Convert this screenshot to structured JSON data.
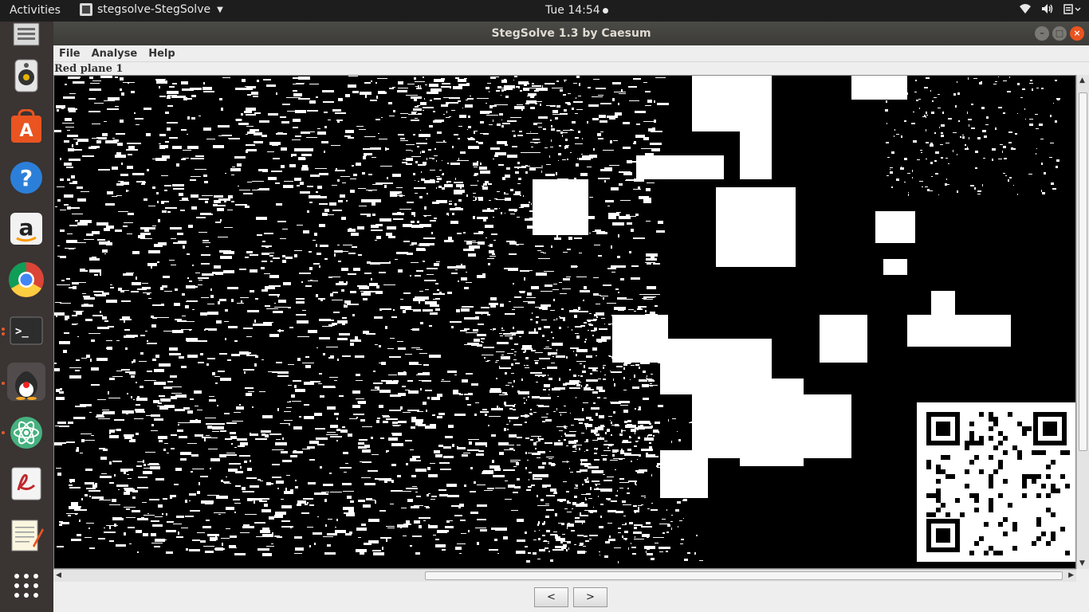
{
  "topbar": {
    "activities": "Activities",
    "app_name": "stegsolve-StegSolve",
    "clock": "Tue 14:54"
  },
  "window": {
    "title": "StegSolve 1.3 by Caesum",
    "menu": [
      "File",
      "Analyse",
      "Help"
    ],
    "plane_label": "Red plane 1",
    "nav_prev": "<",
    "nav_next": ">"
  },
  "dock": {
    "items": [
      "files",
      "rhythmbox",
      "software-center",
      "help",
      "amazon",
      "chrome",
      "terminal",
      "java",
      "atom",
      "pdf-reader",
      "text-editor",
      "app-grid"
    ]
  },
  "icons": {
    "wifi": "wifi-icon",
    "volume": "volume-icon",
    "power": "power-icon"
  },
  "colors": {
    "accent": "#e95420",
    "topbar": "#1d1d1d",
    "dock": "#3a3433"
  }
}
